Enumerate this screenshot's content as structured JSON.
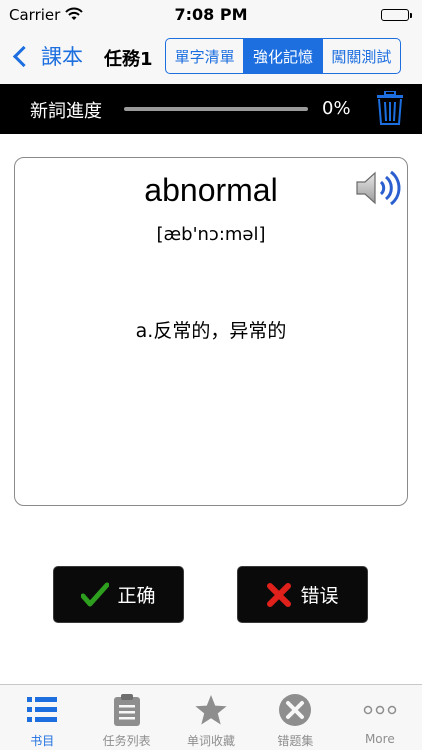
{
  "status_bar": {
    "carrier": "Carrier",
    "time": "7:08 PM"
  },
  "nav": {
    "back_label": "課本",
    "title": "任務1",
    "segments": [
      {
        "label": "單字清單",
        "active": false
      },
      {
        "label": "強化記憶",
        "active": true
      },
      {
        "label": "闖關測試",
        "active": false
      }
    ]
  },
  "progress": {
    "label": "新詞進度",
    "percent_text": "0%",
    "value": 0
  },
  "card": {
    "word": "abnormal",
    "phonetic": "[æb'nɔ:məl]",
    "meaning": "a.反常的，异常的"
  },
  "actions": {
    "correct_label": "正确",
    "wrong_label": "错误"
  },
  "tabbar": {
    "items": [
      {
        "label": "书目",
        "icon": "list-icon",
        "active": true
      },
      {
        "label": "任务列表",
        "icon": "clipboard-icon",
        "active": false
      },
      {
        "label": "单词收藏",
        "icon": "star-icon",
        "active": false
      },
      {
        "label": "错题集",
        "icon": "close-circle-icon",
        "active": false
      },
      {
        "label": "More",
        "icon": "more-dots-icon",
        "active": false
      }
    ]
  },
  "colors": {
    "accent": "#1d6fe0",
    "dark_bar": "#000000",
    "correct": "#2e9e1f",
    "wrong": "#e0201b"
  }
}
